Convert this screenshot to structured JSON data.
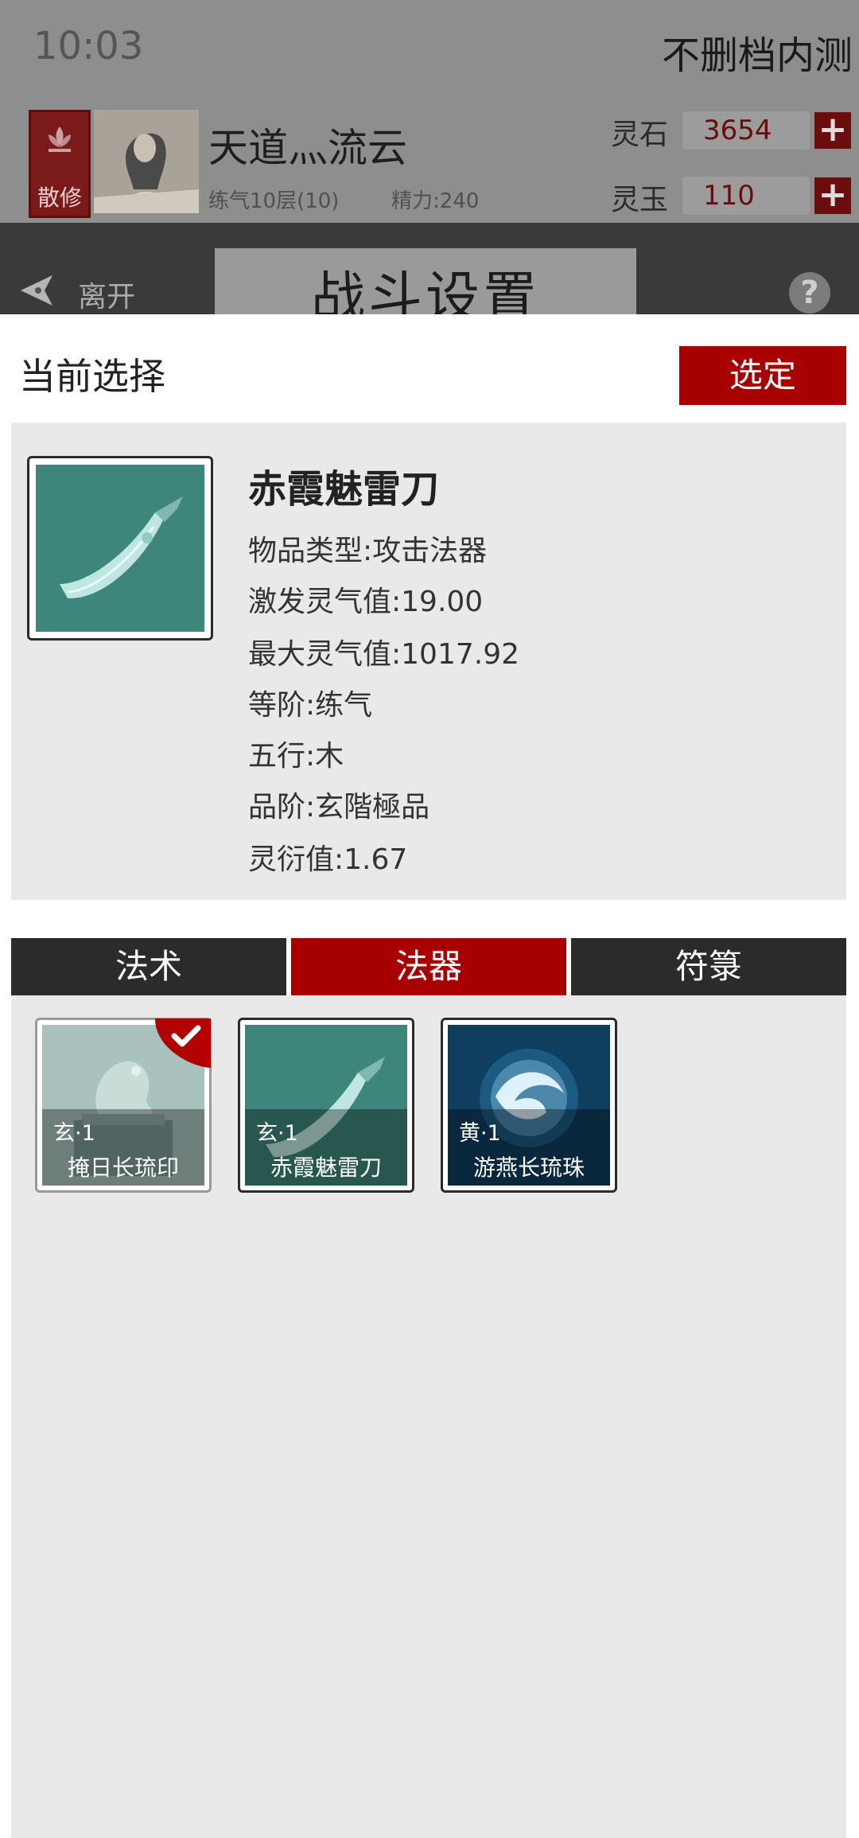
{
  "status_bar": {
    "time": "10:03",
    "test_label": "不删档内测"
  },
  "player": {
    "sect": "散修",
    "name": "天道灬流云",
    "level": "练气10层(10)",
    "energy": "精力:240"
  },
  "resources": [
    {
      "label": "灵石",
      "value": "3654",
      "add": "+"
    },
    {
      "label": "灵玉",
      "value": "110",
      "add": "+"
    }
  ],
  "header": {
    "leave_label": "离开",
    "title": "战斗设置",
    "help": "?"
  },
  "panel": {
    "current_label": "当前选择",
    "select_button": "选定",
    "item": {
      "name": "赤霞魅雷刀",
      "attributes": [
        "物品类型:攻击法器",
        "激发灵气值:19.00",
        "最大灵气值:1017.92",
        "等阶:练气",
        "五行:木",
        "品阶:玄階極品",
        "灵衍值:1.67"
      ]
    },
    "tabs": [
      {
        "label": "法术",
        "active": false
      },
      {
        "label": "法器",
        "active": true
      },
      {
        "label": "符箓",
        "active": false
      }
    ],
    "inventory": [
      {
        "grade": "玄·1",
        "name": "掩日长琉印",
        "icon": "jade-seal-icon",
        "selected": true
      },
      {
        "grade": "玄·1",
        "name": "赤霞魅雷刀",
        "icon": "blade-icon",
        "selected": false
      },
      {
        "grade": "黄·1",
        "name": "游燕长琉珠",
        "icon": "orb-icon",
        "selected": false
      }
    ]
  },
  "colors": {
    "accent": "#a80000",
    "tab_dark": "#2b2b2b",
    "panel_bg": "#e9e9e9"
  }
}
